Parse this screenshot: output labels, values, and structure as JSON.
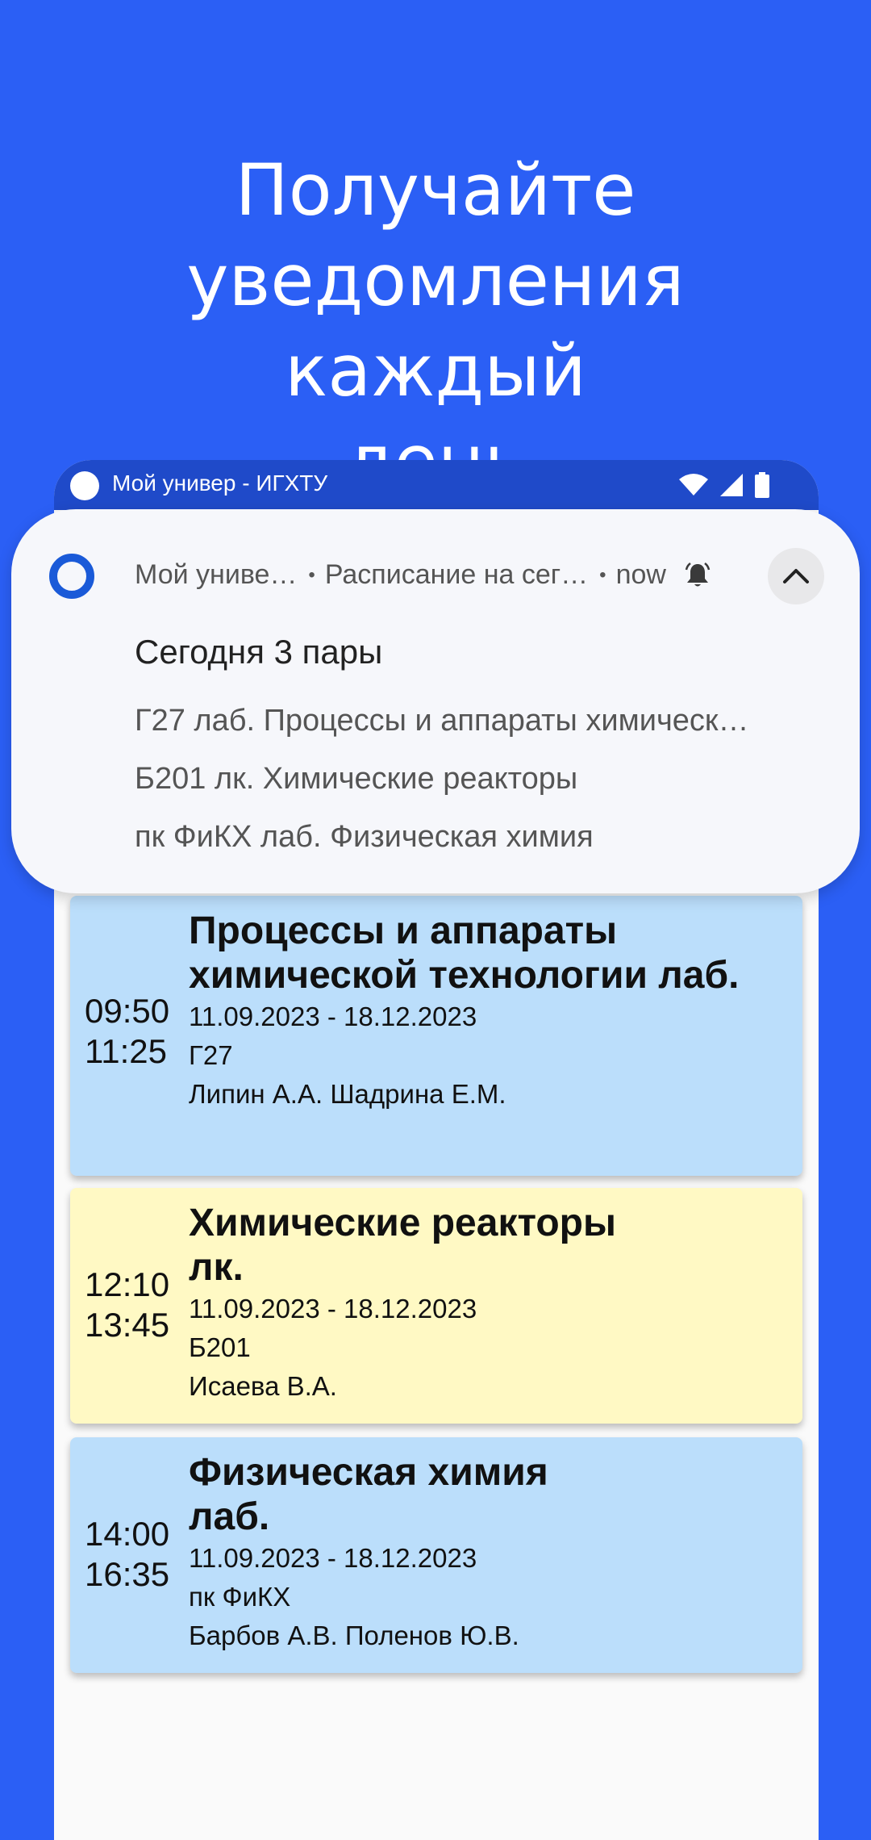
{
  "headline": {
    "line1": "Получайте",
    "line2": "уведомления каждый",
    "line3": "день"
  },
  "statusbar": {
    "title": "Мой универ - ИГХТУ"
  },
  "notification": {
    "app_name": "Мой униве…",
    "channel": "Расписание на сег…",
    "time": "now",
    "title": "Сегодня 3 пары",
    "lines": [
      "Г27 лаб. Процессы и аппараты химическ…",
      "Б201 лк. Химические реакторы",
      "пк ФиКХ лаб. Физическая химия"
    ]
  },
  "schedule": [
    {
      "start": "09:50",
      "end": "11:25",
      "title": "Процессы и аппараты химической технологии лаб.",
      "dates": "11.09.2023 - 18.12.2023",
      "room": "Г27",
      "teachers": "Липин А.А. Шадрина Е.М.",
      "color": "#bbdefb"
    },
    {
      "start": "12:10",
      "end": "13:45",
      "title": "Химические реакторы лк.",
      "dates": "11.09.2023 - 18.12.2023",
      "room": "Б201",
      "teachers": "Исаева В.А.",
      "color": "#fff9c4"
    },
    {
      "start": "14:00",
      "end": "16:35",
      "title": "Физическая химия лаб.",
      "dates": "11.09.2023 - 18.12.2023",
      "room": "пк ФиКХ",
      "teachers": "Барбов А.В. Поленов Ю.В.",
      "color": "#bbdefb"
    }
  ],
  "colors": {
    "background": "#2b5ff5",
    "statusbar": "#1f4ac9",
    "card_blue": "#bbdefb",
    "card_yellow": "#fff9c4",
    "app_icon": "#1a5ad8"
  }
}
